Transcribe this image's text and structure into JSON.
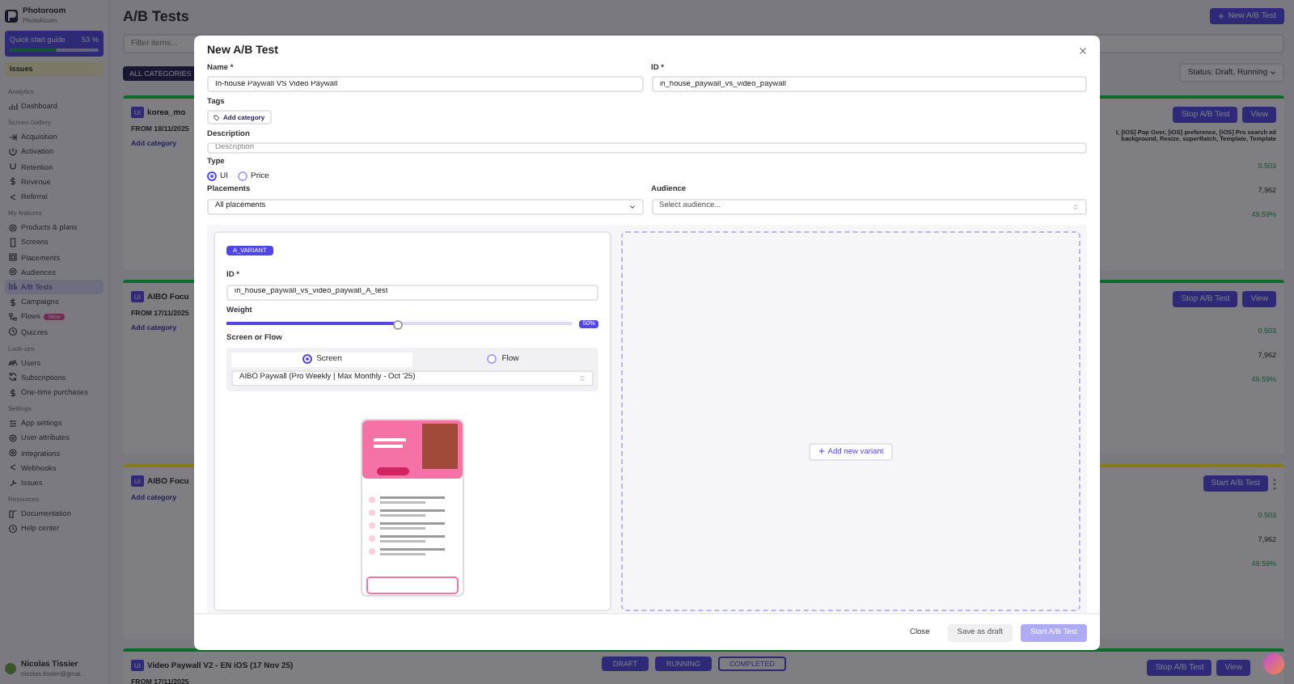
{
  "sidebar": {
    "org_name": "Photoroom",
    "org_sub": "PhotoRoom",
    "quick_start": {
      "label": "Quick start guide",
      "percent": "53 %",
      "level": 0.53
    },
    "issues": "Issues",
    "sections": [
      {
        "title": "Analytics",
        "items": [
          {
            "label": "Dashboard",
            "selected": false
          }
        ]
      },
      {
        "title": "Screen Gallery",
        "items": [
          {
            "label": "Acquisition",
            "selected": false
          },
          {
            "label": "Activation",
            "selected": false
          },
          {
            "label": "Retention",
            "selected": false
          },
          {
            "label": "Revenue",
            "selected": false
          },
          {
            "label": "Referral",
            "selected": false
          }
        ]
      },
      {
        "title": "My features",
        "items": [
          {
            "label": "Products & plans",
            "selected": false
          },
          {
            "label": "Screens",
            "selected": false
          },
          {
            "label": "Placements",
            "selected": false
          },
          {
            "label": "Audiences",
            "selected": false
          },
          {
            "label": "A/B Tests",
            "selected": true
          },
          {
            "label": "Campaigns",
            "selected": false
          },
          {
            "label": "Flows",
            "selected": false,
            "badge": "New"
          },
          {
            "label": "Quizzes",
            "selected": false
          }
        ]
      },
      {
        "title": "Look-ups",
        "items": [
          {
            "label": "Users",
            "selected": false
          },
          {
            "label": "Subscriptions",
            "selected": false
          },
          {
            "label": "One-time purchases",
            "selected": false
          }
        ]
      },
      {
        "title": "Settings",
        "items": [
          {
            "label": "App settings",
            "selected": false
          },
          {
            "label": "User attributes",
            "selected": false
          },
          {
            "label": "Integrations",
            "selected": false
          },
          {
            "label": "Webhooks",
            "selected": false
          },
          {
            "label": "Issues",
            "selected": false
          }
        ]
      },
      {
        "title": "Resources",
        "items": [
          {
            "label": "Documentation",
            "selected": false
          },
          {
            "label": "Help center",
            "selected": false
          }
        ]
      }
    ],
    "user": {
      "name": "Nicolas Tissier",
      "email": "nicolas.tissier@gmai..."
    }
  },
  "header": {
    "title": "A/B Tests",
    "new_button": "New A/B Test",
    "filter_placeholder": "Filter items...",
    "category_button": "ALL CATEGORIES",
    "status_label": "Status:",
    "status_value": "Draft, Running"
  },
  "cards": [
    {
      "color": "#0d6b2a",
      "badge": "UI",
      "title": "korea_mo",
      "date": "FROM 18/11/2025",
      "add_category": "Add category",
      "placements": "t, [iOS] Pop Over, [iOS] preference, [iOS] Pro search ed background, Resize, superBatch, Template, Template",
      "buttons": [
        {
          "kind": "stop",
          "label": "Stop A/B Test"
        },
        {
          "kind": "view",
          "label": "View"
        }
      ],
      "metrics": [
        "0.503",
        "7,962",
        "49.59%"
      ]
    },
    {
      "color": "#0d6b2a",
      "badge": "UI",
      "title": "AIBO Focu",
      "date": "FROM 17/11/2025",
      "add_category": "Add category",
      "buttons": [
        {
          "kind": "stop",
          "label": "Stop A/B Test"
        },
        {
          "kind": "view",
          "label": "View"
        }
      ],
      "metrics": [
        "0.503",
        "7,962",
        "49.59%"
      ]
    },
    {
      "color": "#8a7a1a",
      "badge": "UI",
      "title": "AIBO Focu",
      "add_category": "Add category",
      "buttons": [
        {
          "kind": "start",
          "label": "Start A/B Test"
        },
        {
          "kind": "more"
        }
      ],
      "metrics": [
        "0.503",
        "7,962",
        "49.59%"
      ]
    },
    {
      "color": "#0d6b2a",
      "badge": "UI",
      "title": "Video Paywall V2 - EN iOS (17 Nov 25)",
      "date": "FROM 17/11/2025",
      "buttons": [
        {
          "kind": "stop",
          "label": "Stop A/B Test"
        },
        {
          "kind": "view",
          "label": "View"
        }
      ]
    }
  ],
  "status_chips": [
    {
      "label": "DRAFT",
      "selected": true
    },
    {
      "label": "RUNNING",
      "selected": true
    },
    {
      "label": "COMPLETED",
      "selected": false
    }
  ],
  "modal": {
    "title": "New A/B Test",
    "name": {
      "label": "Name *",
      "value": "In-house Paywall VS Video Paywall"
    },
    "id": {
      "label": "ID *",
      "value": "in_house_paywall_vs_video_paywall"
    },
    "tags": {
      "label": "Tags",
      "button": "Add category"
    },
    "description": {
      "label": "Description",
      "placeholder": "Description"
    },
    "type": {
      "label": "Type",
      "options": [
        {
          "label": "UI",
          "selected": true
        },
        {
          "label": "Price",
          "selected": false
        }
      ]
    },
    "placements": {
      "label": "Placements",
      "value": "All placements"
    },
    "audience": {
      "label": "Audience",
      "placeholder": "Select audience..."
    },
    "variant": {
      "badge": "A_VARIANT",
      "id_label": "ID *",
      "id_value": "in_house_paywall_vs_video_paywall_A_test",
      "weight_label": "Weight",
      "weight": {
        "level": 0.5,
        "reading": "50%"
      },
      "source_label": "Screen or Flow",
      "sources": [
        {
          "label": "Screen",
          "selected": true
        },
        {
          "label": "Flow",
          "selected": false
        }
      ],
      "screen": "AIBO Paywall (Pro Weekly | Max Monthly - Oct '25)"
    },
    "add_variant": "Add new variant",
    "footer": [
      {
        "kind": "text",
        "label": "Close"
      },
      {
        "kind": "secondary",
        "label": "Save as draft"
      },
      {
        "kind": "primary",
        "label": "Start A/B Test",
        "disabled": true
      }
    ]
  }
}
